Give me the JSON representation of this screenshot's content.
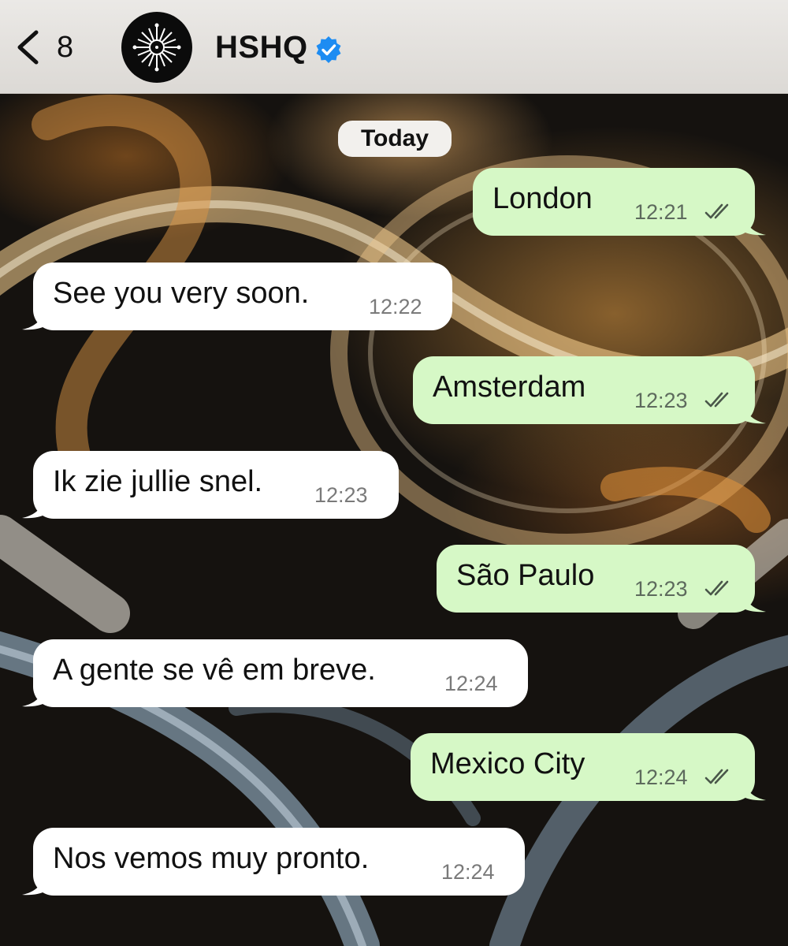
{
  "header": {
    "back_label": "8",
    "contact_name": "HSHQ"
  },
  "chat": {
    "date_label": "Today",
    "messages": [
      {
        "direction": "outgoing",
        "text": "London",
        "time": "12:21",
        "status": "read"
      },
      {
        "direction": "incoming",
        "text": "See you very soon.",
        "time": "12:22"
      },
      {
        "direction": "outgoing",
        "text": "Amsterdam",
        "time": "12:23",
        "status": "read"
      },
      {
        "direction": "incoming",
        "text": "Ik zie jullie snel.",
        "time": "12:23"
      },
      {
        "direction": "outgoing",
        "text": "São Paulo",
        "time": "12:23",
        "status": "read"
      },
      {
        "direction": "incoming",
        "text": "A gente se vê em breve.",
        "time": "12:24"
      },
      {
        "direction": "outgoing",
        "text": "Mexico City",
        "time": "12:24",
        "status": "read"
      },
      {
        "direction": "incoming",
        "text": "Nos vemos muy pronto.",
        "time": "12:24"
      }
    ]
  },
  "colors": {
    "outgoing_bubble": "#d6f8c6",
    "incoming_bubble": "#ffffff",
    "verified_badge": "#1d8cf2"
  },
  "icons": {
    "back": "chevron-left-icon",
    "verified": "verified-badge-icon",
    "read_receipt": "double-check-icon"
  }
}
